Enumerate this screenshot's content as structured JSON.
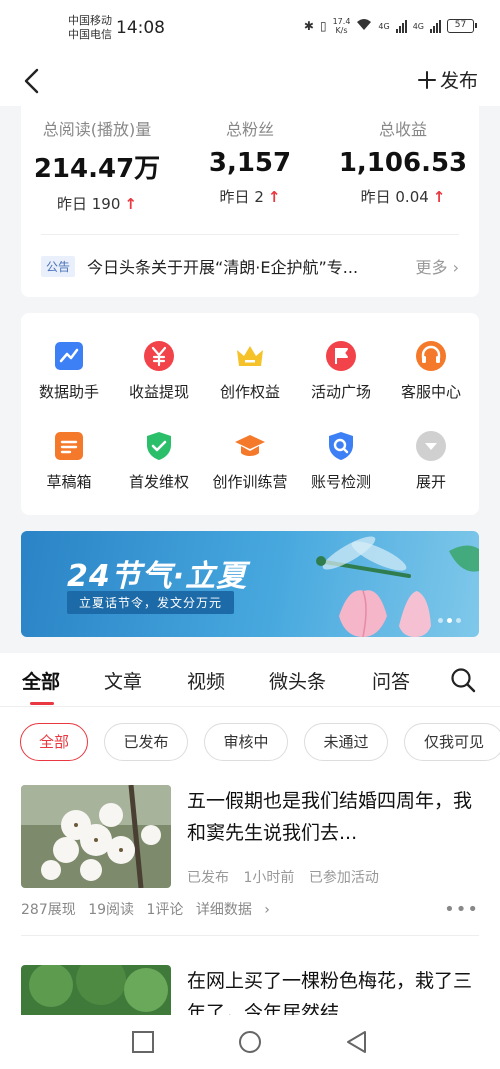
{
  "status_bar": {
    "carrier_1": "中国移动",
    "carrier_2": "中国电信",
    "time": "14:08",
    "net_speed": "17.4",
    "net_unit": "K/s",
    "signal_1": "4G",
    "signal_2": "4G",
    "battery": "57"
  },
  "nav": {
    "publish_label": "发布"
  },
  "stats": [
    {
      "label": "总阅读(播放)量",
      "value": "214.47万",
      "delta": "昨日 190"
    },
    {
      "label": "总粉丝",
      "value": "3,157",
      "delta": "昨日 2"
    },
    {
      "label": "总收益",
      "value": "1,106.53",
      "delta": "昨日 0.04"
    }
  ],
  "notice": {
    "tag": "公告",
    "text": "今日头条关于开展“清朗·E企护航”专...",
    "more": "更多"
  },
  "tools": [
    {
      "label": "数据助手",
      "icon": "chart-icon",
      "color": "#3d7ff5"
    },
    {
      "label": "收益提现",
      "icon": "yuan-icon",
      "color": "#f2424a"
    },
    {
      "label": "创作权益",
      "icon": "crown-icon",
      "color": "#f5c22a"
    },
    {
      "label": "活动广场",
      "icon": "flag-icon",
      "color": "#f2424a"
    },
    {
      "label": "客服中心",
      "icon": "headset-icon",
      "color": "#f5792a"
    },
    {
      "label": "草稿箱",
      "icon": "draft-icon",
      "color": "#f5792a"
    },
    {
      "label": "首发维权",
      "icon": "shield-icon",
      "color": "#2bbf6a"
    },
    {
      "label": "创作训练营",
      "icon": "graduation-cap-icon",
      "color": "#f5792a"
    },
    {
      "label": "账号检测",
      "icon": "account-check-icon",
      "color": "#3d7ff5"
    },
    {
      "label": "展开",
      "icon": "expand-icon",
      "color": "#cccccc"
    }
  ],
  "banner": {
    "title": "24节气·立夏",
    "subtitle": "立夏话节令，发文分万元"
  },
  "tabs": [
    "全部",
    "文章",
    "视频",
    "微头条",
    "问答"
  ],
  "filters": [
    "全部",
    "已发布",
    "审核中",
    "未通过",
    "仅我可见"
  ],
  "articles": [
    {
      "title": "五一假期也是我们结婚四周年，我和窦先生说我们去...",
      "meta": [
        "已发布",
        "1小时前",
        "已参加活动"
      ],
      "stats": [
        "287展现",
        "19阅读",
        "1评论",
        "详细数据"
      ]
    },
    {
      "title": "在网上买了一棵粉色梅花，栽了三年了，今年居然结..."
    }
  ]
}
